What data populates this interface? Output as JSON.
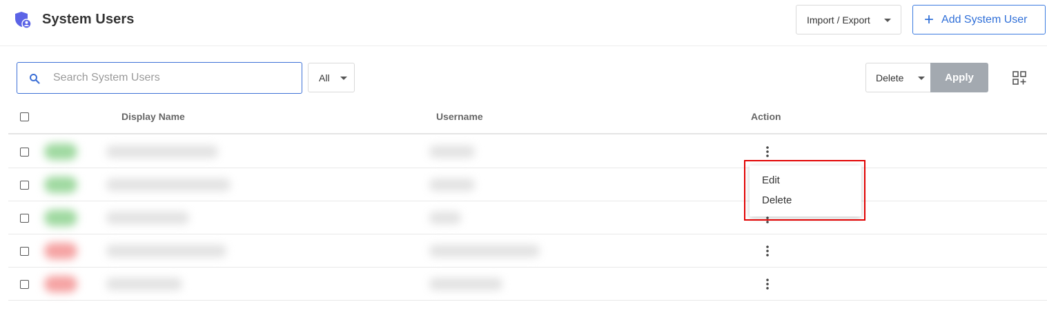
{
  "header": {
    "title": "System Users",
    "import_export_label": "Import / Export",
    "add_button_label": "Add System User",
    "brand_color": "#5b63e6",
    "accent_color": "#2f6fd8"
  },
  "toolbar": {
    "search_placeholder": "Search System Users",
    "filter_value": "All",
    "bulk_action_value": "Delete",
    "apply_label": "Apply"
  },
  "table": {
    "columns": [
      "Display Name",
      "Username",
      "Action"
    ],
    "rows": [
      {
        "status_color": "#9fd9a0"
      },
      {
        "status_color": "#9fd9a0"
      },
      {
        "status_color": "#9fd9a0"
      },
      {
        "status_color": "#f5a3a3"
      },
      {
        "status_color": "#f5a3a3"
      }
    ]
  },
  "context_menu": {
    "items": [
      "Edit",
      "Delete"
    ],
    "highlight_color": "#e10000"
  }
}
